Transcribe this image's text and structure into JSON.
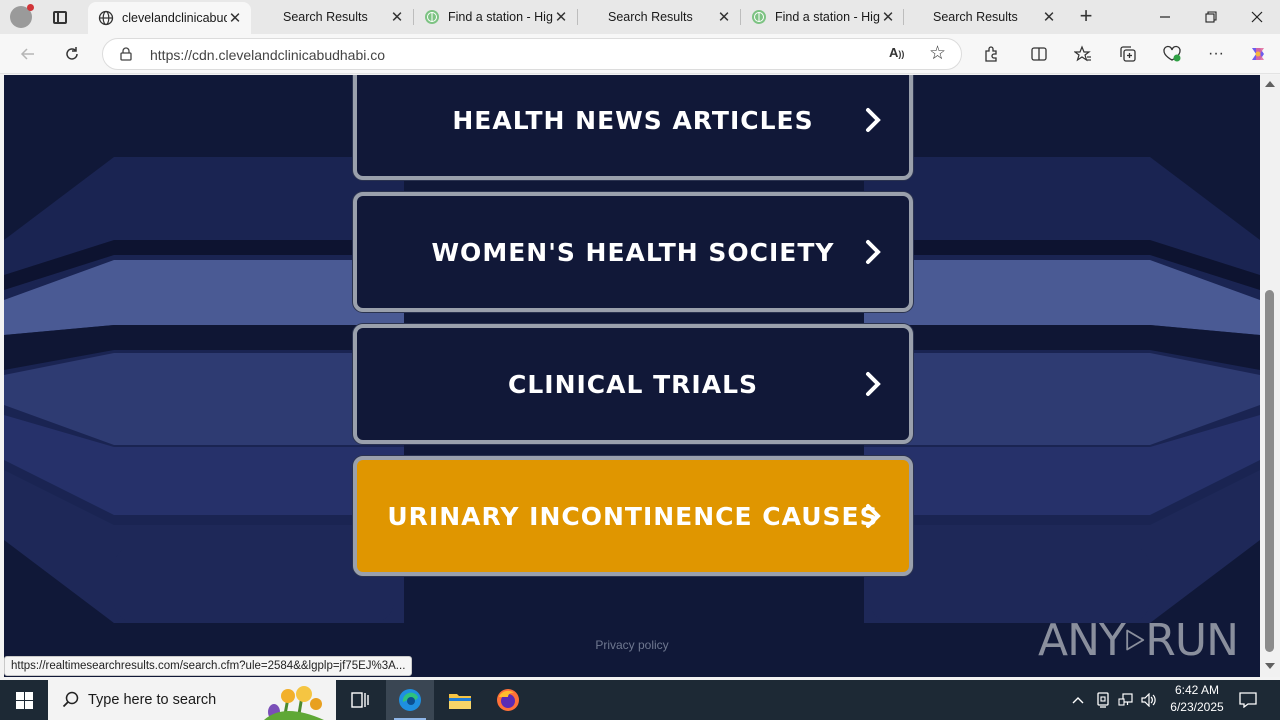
{
  "browser": {
    "tabs": [
      {
        "title": "clevelandclinicabud",
        "active": true,
        "favicon": "globe-icon"
      },
      {
        "title": "Search Results",
        "active": false,
        "favicon": "none"
      },
      {
        "title": "Find a station - Hig",
        "active": false,
        "favicon": "station-icon"
      },
      {
        "title": "Search Results",
        "active": false,
        "favicon": "none"
      },
      {
        "title": "Find a station - Hig",
        "active": false,
        "favicon": "station-icon"
      },
      {
        "title": "Search Results",
        "active": false,
        "favicon": "none"
      }
    ],
    "address": "https://cdn.clevelandclinicabudhabi.co",
    "status_url": "https://realtimesearchresults.com/search.cfm?ule=2584&&lgplp=jf75EJ%3A..."
  },
  "page": {
    "menu_items": [
      {
        "label": "HEALTH NEWS ARTICLES",
        "highlight": false
      },
      {
        "label": "WOMEN'S HEALTH SOCIETY",
        "highlight": false
      },
      {
        "label": "CLINICAL TRIALS",
        "highlight": false
      },
      {
        "label": "URINARY INCONTINENCE CAUSES",
        "highlight": true
      }
    ],
    "privacy_link": "Privacy policy",
    "watermark_left": "ANY",
    "watermark_right": "RUN",
    "colors": {
      "background": "#101838",
      "highlight": "#e09600",
      "button_border": "#9aa0ac"
    }
  },
  "taskbar": {
    "search_placeholder": "Type here to search",
    "time": "6:42 AM",
    "date": "6/23/2025"
  }
}
